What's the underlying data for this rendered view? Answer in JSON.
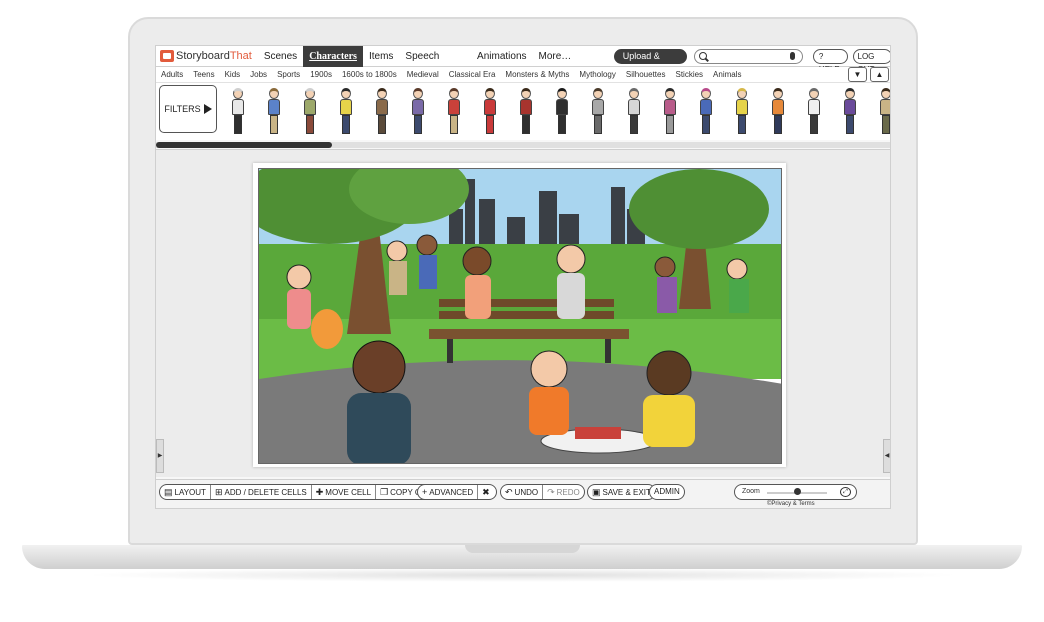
{
  "nav": {
    "logo_main": "Storyboard",
    "logo_accent": "That",
    "items": [
      "Scenes",
      "Characters",
      "Items",
      "Speech Bubbles",
      "Animations",
      "More… ▾"
    ],
    "active_index": 1,
    "upload_label": "Upload & Embed",
    "search_value": "",
    "help_label": "? HELP",
    "logout_label": "LOG OUT"
  },
  "categories": {
    "items": [
      "Adults",
      "Teens",
      "Kids",
      "Jobs",
      "Sports",
      "1900s",
      "1600s to 1800s",
      "Medieval",
      "Classical Era",
      "Monsters & Myths",
      "Mythology",
      "Silhouettes",
      "Stickies",
      "Animals"
    ],
    "active_index": 0,
    "down_icon": "▼",
    "up_icon": "▲"
  },
  "strip": {
    "filters_label": "FILTERS",
    "characters": [
      {
        "shirt": "#e8e8e8",
        "pants": "#2f2f2f",
        "hair": "#cfcfcf"
      },
      {
        "shirt": "#5b82c9",
        "pants": "#c9b486",
        "hair": "#8a6a3a"
      },
      {
        "shirt": "#9ca86a",
        "pants": "#8a4a3a",
        "hair": "#cfcfcf"
      },
      {
        "shirt": "#e6d34a",
        "pants": "#3c4a6e",
        "hair": "#2a2a2a"
      },
      {
        "shirt": "#8a6a4a",
        "pants": "#5a4a3a",
        "hair": "#3a2a1a"
      },
      {
        "shirt": "#7a6aa8",
        "pants": "#3c4a6e",
        "hair": "#5a3a2a"
      },
      {
        "shirt": "#c9413a",
        "pants": "#c9b486",
        "hair": "#5a3a2a"
      },
      {
        "shirt": "#c93a3a",
        "pants": "#c93a3a",
        "hair": "#3a2a1a"
      },
      {
        "shirt": "#a8342e",
        "pants": "#2f2f2f",
        "hair": "#3a2a1a"
      },
      {
        "shirt": "#2f2f2f",
        "pants": "#2f2f2f",
        "hair": "#1a1a1a"
      },
      {
        "shirt": "#a8a8a8",
        "pants": "#6a6a6a",
        "hair": "#4a3a2a"
      },
      {
        "shirt": "#d6d6d6",
        "pants": "#3a3a3a",
        "hair": "#6a6a6a"
      },
      {
        "shirt": "#b85c8a",
        "pants": "#9a9a9a",
        "hair": "#2a2a2a"
      },
      {
        "shirt": "#4a6ab8",
        "pants": "#3c4a6e",
        "hair": "#b84a8a"
      },
      {
        "shirt": "#e6d34a",
        "pants": "#3c4a6e",
        "hair": "#d6b84a"
      },
      {
        "shirt": "#e6893a",
        "pants": "#2f3a5a",
        "hair": "#3a2a1a"
      },
      {
        "shirt": "#f0f0f0",
        "pants": "#3a3a3a",
        "hair": "#6a6a6a"
      },
      {
        "shirt": "#6a4a9a",
        "pants": "#3c4a6e",
        "hair": "#2a2a2a"
      },
      {
        "shirt": "#c9b486",
        "pants": "#6a6a4a",
        "hair": "#3a2a1a"
      }
    ]
  },
  "toolbar": {
    "layout": "LAYOUT",
    "add_delete": "ADD / DELETE CELLS",
    "move": "MOVE CELL",
    "copy": "COPY CELL",
    "advanced": "ADVANCED",
    "undo": "UNDO",
    "redo": "REDO",
    "save_exit": "SAVE & EXIT",
    "admin": "ADMIN",
    "zoom_label": "Zoom",
    "zoom_level": 0.5,
    "privacy": "©Privacy & Terms"
  },
  "colors": {
    "accent": "#e25b3c",
    "dark": "#3c3c3c",
    "sky": "#a9d5ef",
    "grass": "#5aa83a",
    "path": "#7a7a7a"
  }
}
